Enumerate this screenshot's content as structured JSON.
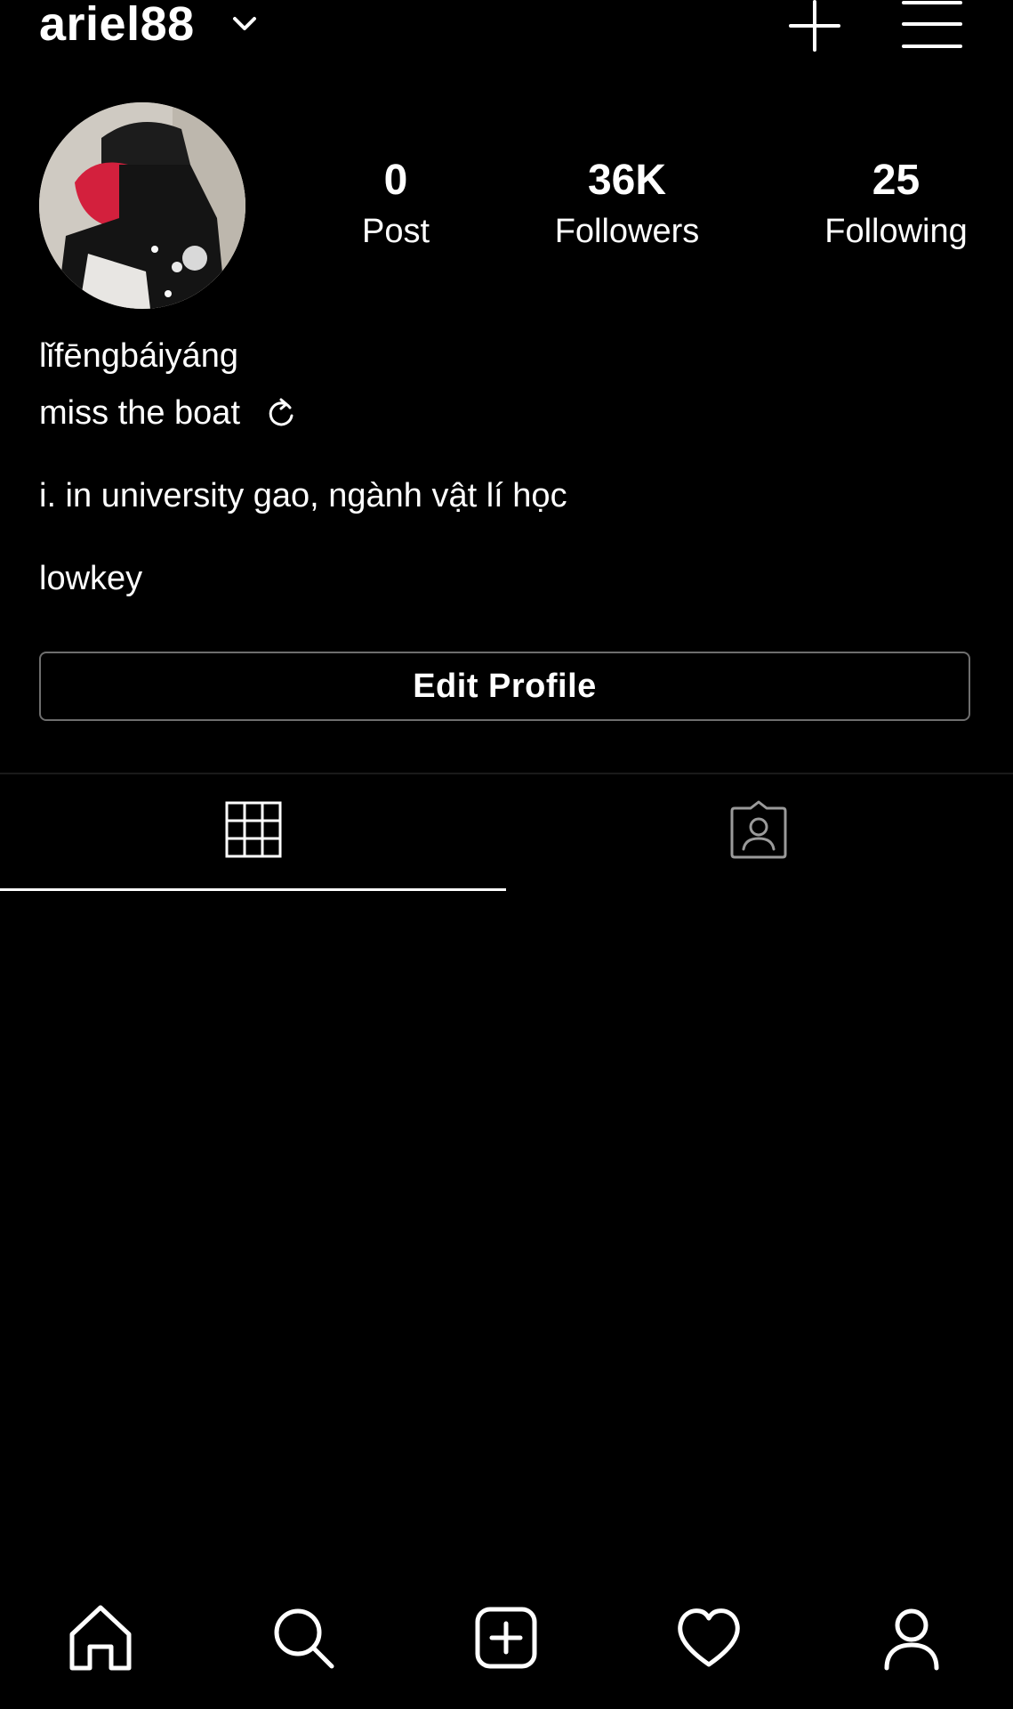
{
  "header": {
    "username": "ariel88",
    "icons": [
      "chevron-down-icon",
      "plus-icon",
      "hamburger-menu-icon"
    ]
  },
  "profile": {
    "avatar": "avatar-photo",
    "stats": [
      {
        "value": "0",
        "label": "Post"
      },
      {
        "value": "36K",
        "label": "Followers"
      },
      {
        "value": "25",
        "label": "Following"
      }
    ]
  },
  "bio": {
    "name": "lǐfēngbáiyáng",
    "line1": "miss the boat",
    "line2": "i. in university gao, ngành vật lí học",
    "line3": "lowkey"
  },
  "actions": {
    "edit_profile": "Edit Profile"
  },
  "tabs": {
    "active": "grid",
    "items": [
      "grid-icon",
      "tagged-icon"
    ]
  },
  "bottom_nav": {
    "items": [
      "home-icon",
      "search-icon",
      "create-icon",
      "heart-icon",
      "profile-icon"
    ]
  },
  "colors": {
    "background": "#000000",
    "text": "#ffffff",
    "border": "#6e6e6e"
  }
}
